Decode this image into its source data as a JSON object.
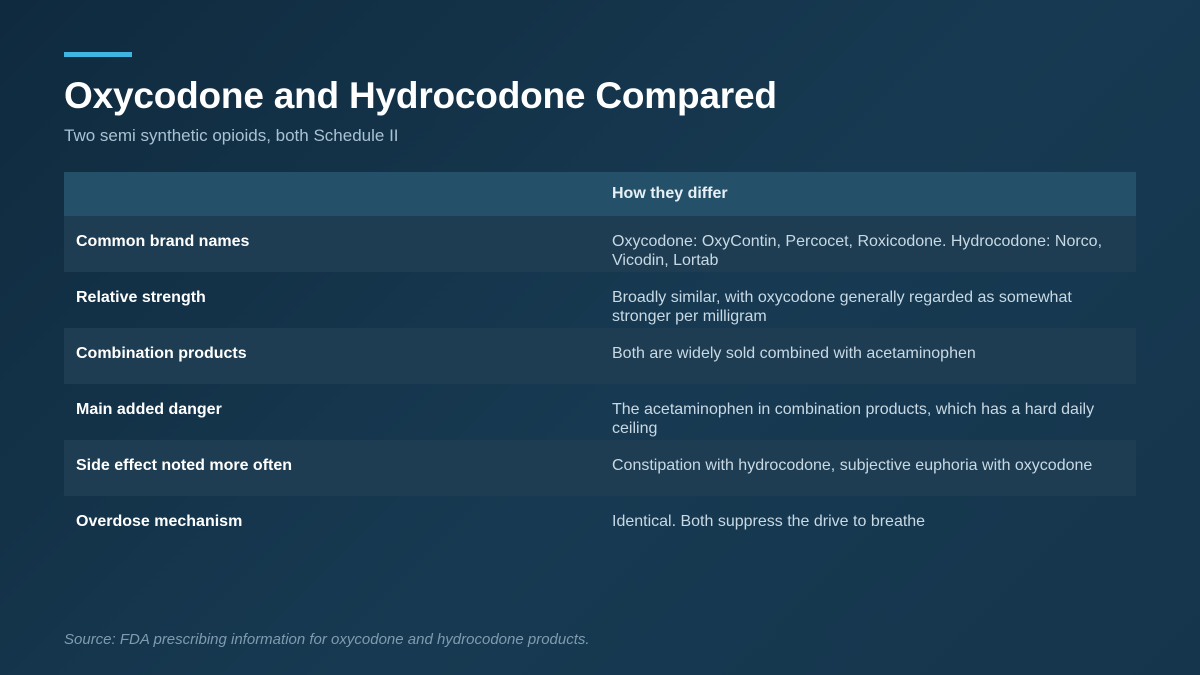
{
  "slide": {
    "title": "Oxycodone and Hydrocodone Compared",
    "subtitle": "Two semi synthetic opioids, both Schedule II",
    "source": "Source: FDA prescribing information for oxycodone and hydrocodone products.",
    "accent_color": "#3fb4e0"
  },
  "table": {
    "headers": [
      "",
      "How they differ"
    ],
    "rows": [
      {
        "label": "Common brand names",
        "value": "Oxycodone: OxyContin, Percocet, Roxicodone. Hydrocodone: Norco, Vicodin, Lortab"
      },
      {
        "label": "Relative strength",
        "value": "Broadly similar, with oxycodone generally regarded as somewhat stronger per milligram"
      },
      {
        "label": "Combination products",
        "value": "Both are widely sold combined with acetaminophen"
      },
      {
        "label": "Main added danger",
        "value": "The acetaminophen in combination products, which has a hard daily ceiling"
      },
      {
        "label": "Side effect noted more often",
        "value": "Constipation with hydrocodone, subjective euphoria with oxycodone"
      },
      {
        "label": "Overdose mechanism",
        "value": "Identical. Both suppress the drive to breathe"
      }
    ]
  }
}
